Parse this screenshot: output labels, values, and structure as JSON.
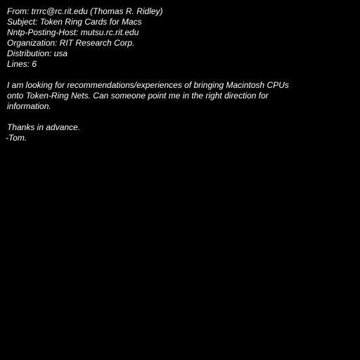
{
  "header": {
    "from": "From: trrrc@rc.rit.edu (Thomas R. Ridley)",
    "subject": "Subject: Token Ring Cards for Macs",
    "nntp_host": "Nntp-Posting-Host: mutsu.rc.rit.edu",
    "organization": "Organization: RIT Research Corp.",
    "distribution": "Distribution: usa",
    "lines": "Lines: 6"
  },
  "body": {
    "paragraph": [
      "I am looking for recommendations/experiences of bringing Macintosh CPUs",
      "onto Token-Ring Nets. Can someone point me in the right direction for",
      "information."
    ],
    "signoff": [
      "Thanks in advance.",
      "-Tom."
    ]
  }
}
